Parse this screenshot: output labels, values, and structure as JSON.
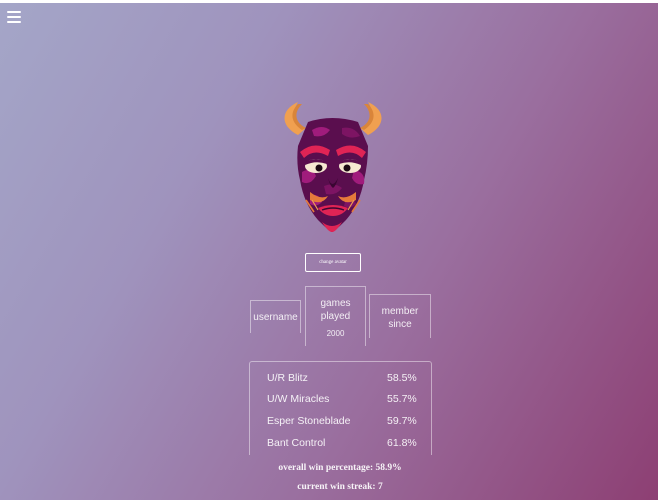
{
  "nav": {
    "menu_icon": "hamburger-menu-icon"
  },
  "profile": {
    "avatar_icon": "demon-mask-avatar-icon",
    "change_avatar_label": "change avatar"
  },
  "stats": {
    "username_label": "username",
    "games_played_label": "games played",
    "games_played_value": "2000",
    "member_since_label": "member since"
  },
  "decks": [
    {
      "name": "U/R Blitz",
      "win_pct": "58.5%"
    },
    {
      "name": "U/W Miracles",
      "win_pct": "55.7%"
    },
    {
      "name": "Esper Stoneblade",
      "win_pct": "59.7%"
    },
    {
      "name": "Bant Control",
      "win_pct": "61.8%"
    }
  ],
  "summary": {
    "overall_win_percentage": "overall win percentage: 58.9%",
    "current_win_streak": "current win streak: 7"
  },
  "colors": {
    "gradient_start": "#a4a6c8",
    "gradient_end": "#8d3f73",
    "mask_purple": "#5a0e4e",
    "mask_magenta": "#a01c7c",
    "horn_orange": "#f0a050",
    "brow_red": "#e02455"
  }
}
